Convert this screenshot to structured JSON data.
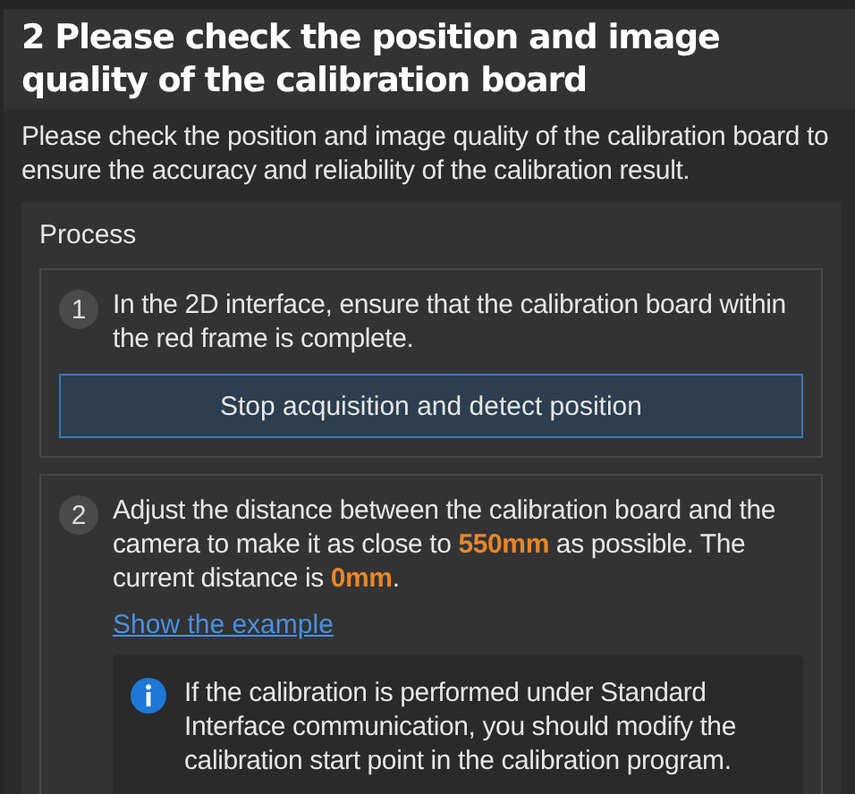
{
  "header": {
    "title": "2 Please check the position and image quality of the calibration board"
  },
  "description": "Please check the position and image quality of the calibration board to ensure the accuracy and reliability of the calibration result.",
  "process": {
    "title": "Process",
    "steps": [
      {
        "number": "1",
        "text": "In the 2D interface, ensure that the calibration board within the red frame is complete.",
        "button": "Stop acquisition and detect position"
      },
      {
        "number": "2",
        "text": "Adjust the distance between the calibration board and the camera to make it as close to **550mm** as possible. The current distance is **0mm**.",
        "link": "Show the example",
        "note": "If the calibration is performed under Standard Interface communication, you should modify the calibration start point in the calibration program."
      }
    ]
  }
}
